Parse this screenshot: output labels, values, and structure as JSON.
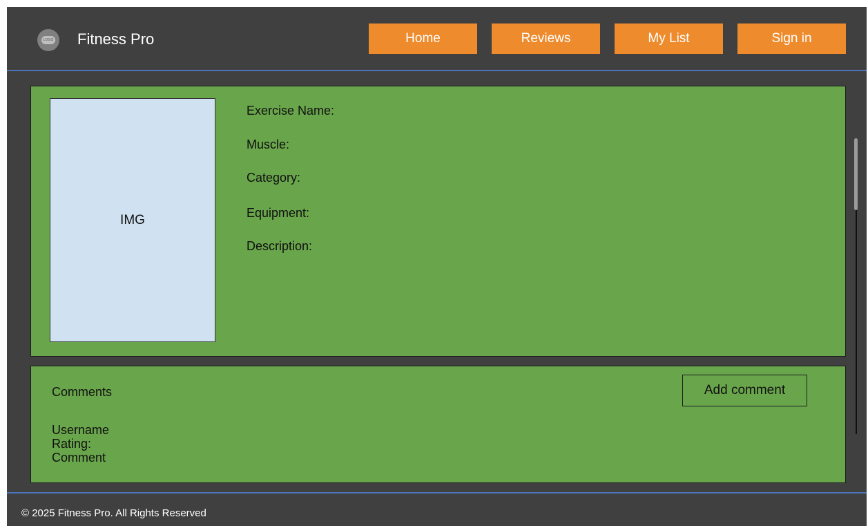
{
  "header": {
    "logo_text": "LOGO",
    "app_title": "Fitness Pro",
    "nav": [
      {
        "label": "Home"
      },
      {
        "label": "Reviews"
      },
      {
        "label": "My List"
      },
      {
        "label": "Sign in"
      }
    ]
  },
  "exercise": {
    "image_placeholder": "IMG",
    "fields": {
      "name": "Exercise Name:",
      "muscle": "Muscle:",
      "category": "Category:",
      "equipment": "Equipment:",
      "description": "Description:"
    }
  },
  "comments": {
    "title": "Comments",
    "add_button": "Add comment",
    "entry": {
      "username": "Username",
      "rating": "Rating:",
      "comment": "Comment"
    }
  },
  "footer": {
    "copyright": "© 2025 Fitness Pro. All Rights Reserved"
  },
  "colors": {
    "background": "#404040",
    "accent": "#ee8b2d",
    "panel": "#69a54b",
    "image_placeholder": "#d0e2f1",
    "divider": "#4a73b8"
  }
}
